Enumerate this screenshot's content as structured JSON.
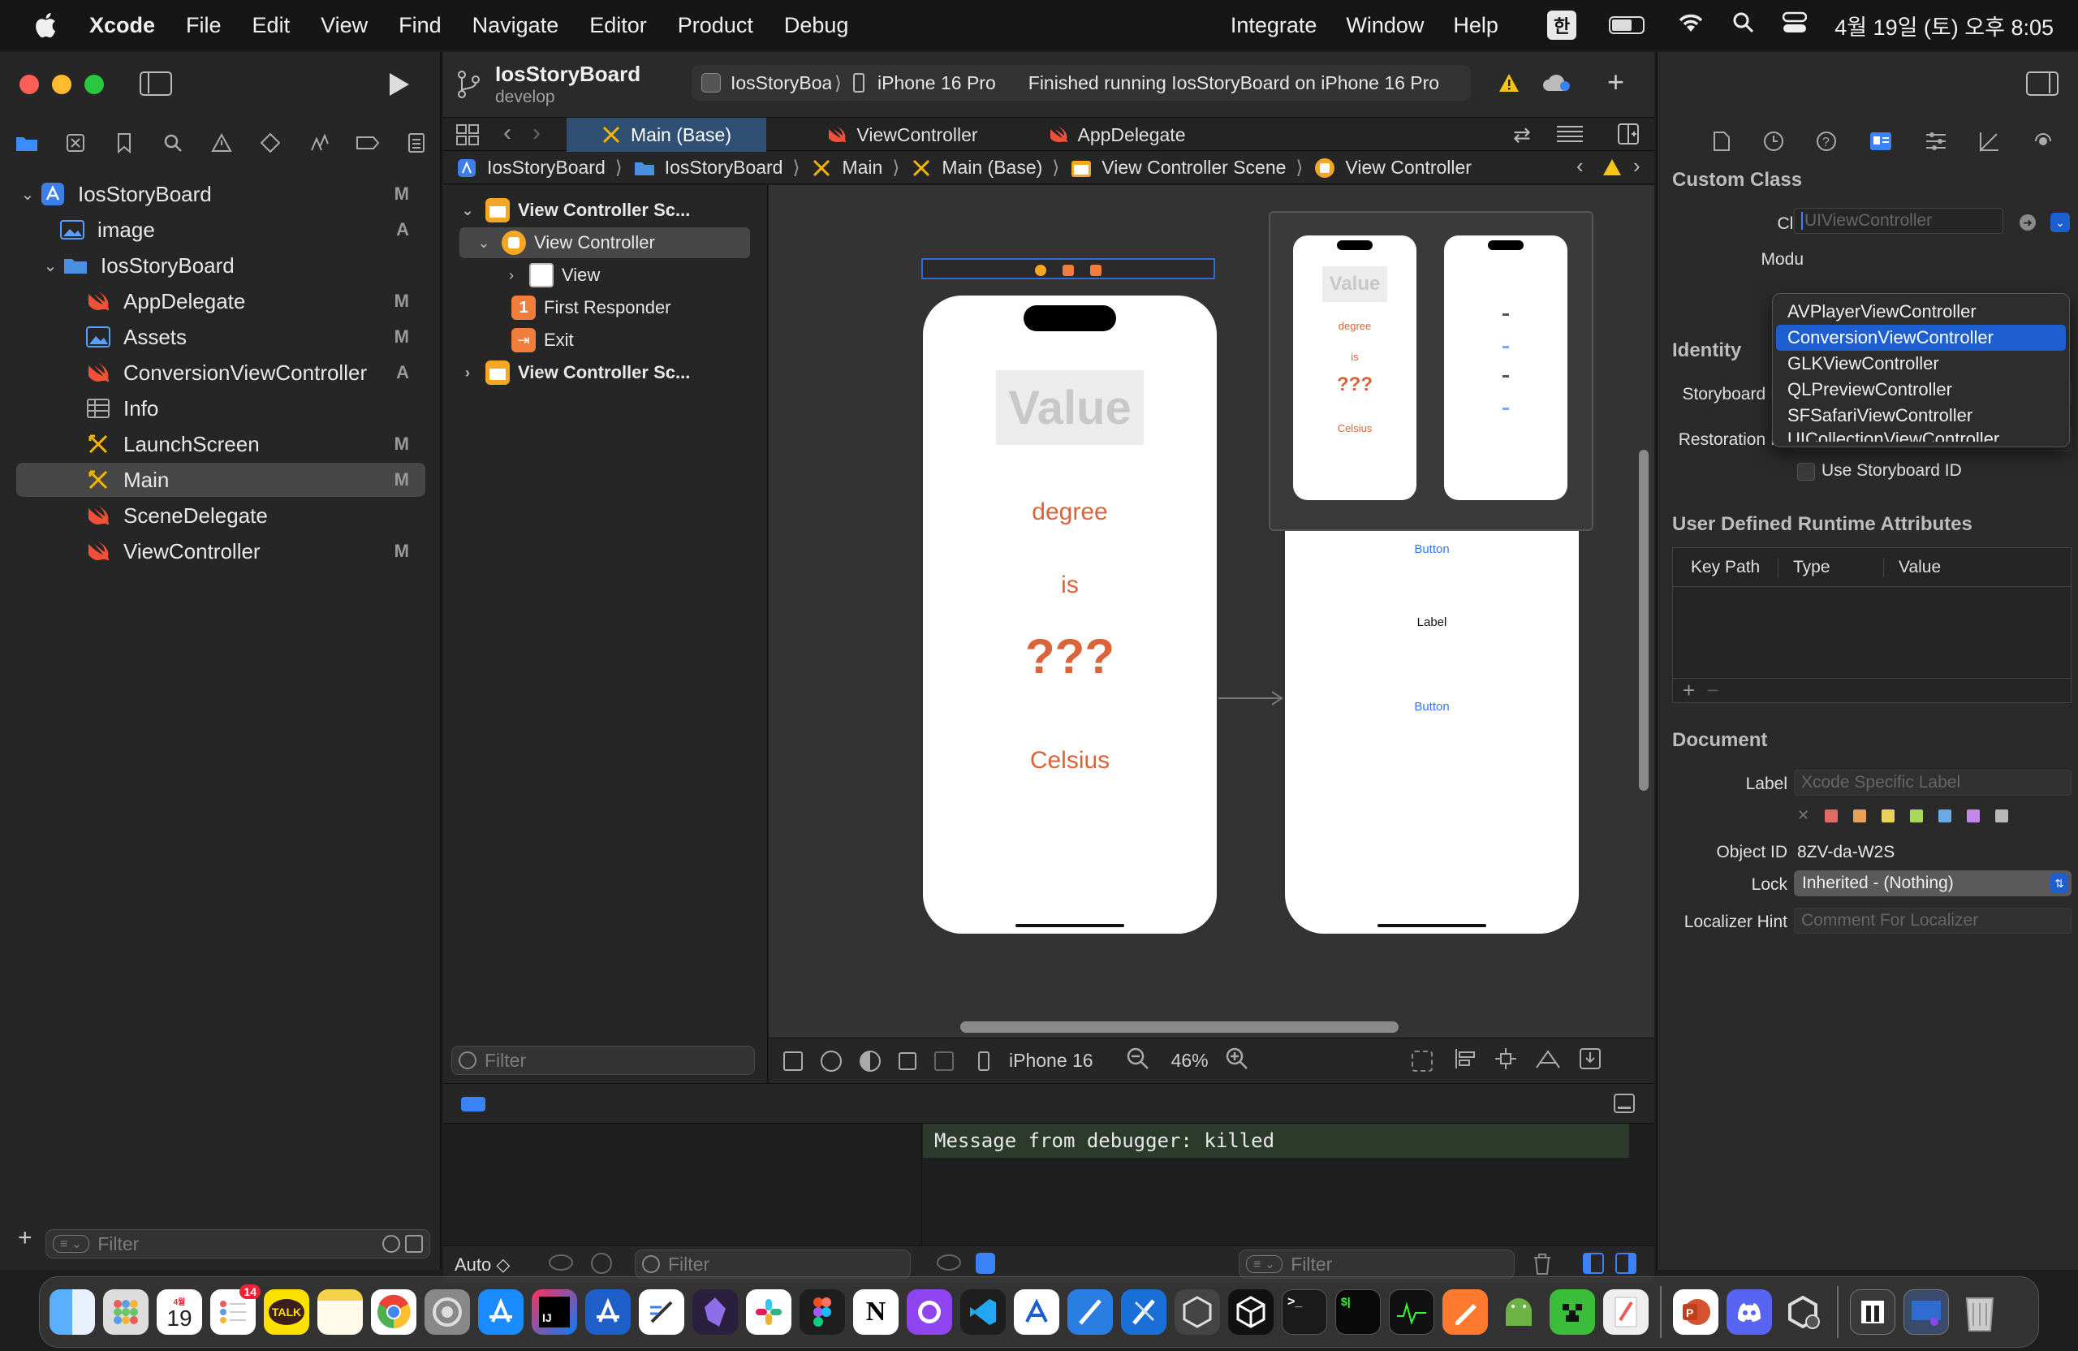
{
  "menubar": {
    "app": "Xcode",
    "items": [
      "File",
      "Edit",
      "View",
      "Find",
      "Navigate",
      "Editor",
      "Product",
      "Debug"
    ],
    "right_items": [
      "Integrate",
      "Window",
      "Help"
    ],
    "input_method": "한",
    "clock": "4월 19일 (토) 오후 8:05"
  },
  "toolbar": {
    "project": "IosStoryBoard",
    "branch": "develop",
    "scheme": "IosStoryBoa",
    "device": "iPhone 16 Pro",
    "status": "Finished running IosStoryBoard on iPhone 16 Pro"
  },
  "navigator": {
    "items": [
      {
        "label": "IosStoryBoard",
        "status": "M"
      },
      {
        "label": "image",
        "status": "A"
      },
      {
        "label": "IosStoryBoard",
        "status": ""
      },
      {
        "label": "AppDelegate",
        "status": "M"
      },
      {
        "label": "Assets",
        "status": "M"
      },
      {
        "label": "ConversionViewController",
        "status": "A"
      },
      {
        "label": "Info",
        "status": ""
      },
      {
        "label": "LaunchScreen",
        "status": "M"
      },
      {
        "label": "Main",
        "status": "M"
      },
      {
        "label": "SceneDelegate",
        "status": ""
      },
      {
        "label": "ViewController",
        "status": "M"
      }
    ],
    "filter_placeholder": "Filter"
  },
  "tabs": [
    "Main (Base)",
    "ViewController",
    "AppDelegate"
  ],
  "jumpbar": [
    "IosStoryBoard",
    "IosStoryBoard",
    "Main",
    "Main (Base)",
    "View Controller Scene",
    "View Controller"
  ],
  "outline": {
    "items": [
      "View Controller Sc...",
      "View Controller",
      "View",
      "First Responder",
      "Exit",
      "View Controller Sc..."
    ],
    "filter_placeholder": "Filter"
  },
  "canvas": {
    "phone1": {
      "value": "Value",
      "degree": "degree",
      "is": "is",
      "qqq": "???",
      "celsius": "Celsius"
    },
    "mini": {
      "value": "Value",
      "degree": "degree",
      "is": "is",
      "qqq": "???",
      "celsius": "Celsius"
    },
    "phone2": {
      "button1": "Button",
      "label": "Label",
      "button2": "Button"
    },
    "device": "iPhone 16",
    "zoom": "46%"
  },
  "debug": {
    "console_message": "Message from debugger: killed",
    "auto_label": "Auto ◇",
    "filter_placeholder": "Filter"
  },
  "inspector": {
    "custom_class_header": "Custom Class",
    "class_label": "Class",
    "class_placeholder": "UIViewController",
    "module_label": "Modu",
    "dropdown": [
      "AVPlayerViewController",
      "ConversionViewController",
      "GLKViewController",
      "QLPreviewController",
      "SFSafariViewController",
      "UICollectionViewController"
    ],
    "identity_header": "Identity",
    "storyboard_id_label": "Storyboard ID",
    "restoration_id_label": "Restoration ID",
    "use_storyboard_id": "Use Storyboard ID",
    "udra_header": "User Defined Runtime Attributes",
    "udra_cols": [
      "Key Path",
      "Type",
      "Value"
    ],
    "document_header": "Document",
    "doc_label_label": "Label",
    "doc_label_placeholder": "Xcode Specific Label",
    "object_id_label": "Object ID",
    "object_id": "8ZV-da-W2S",
    "lock_label": "Lock",
    "lock_value": "Inherited - (Nothing)",
    "localizer_label": "Localizer Hint",
    "localizer_placeholder": "Comment For Localizer",
    "label_colors": [
      "#e46a6a",
      "#e8a05a",
      "#e8d25a",
      "#a8d85a",
      "#6aa8e8",
      "#c08ae8",
      "#b8b8b8"
    ]
  },
  "dock": {
    "calendar_day": "19",
    "calendar_month": "4월",
    "reminder_badge": "14",
    "talk_label": "TALK"
  }
}
